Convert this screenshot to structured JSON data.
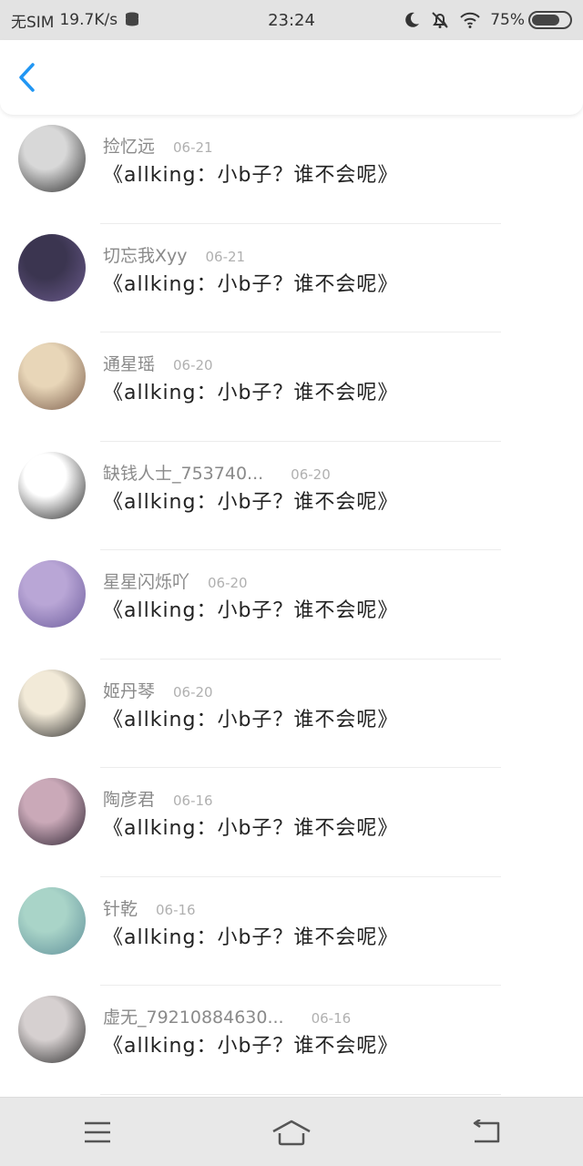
{
  "status_bar": {
    "carrier": "无SIM",
    "speed": "19.7K/s",
    "time": "23:24",
    "battery_text": "75%",
    "battery_level": 0.75,
    "icons": [
      "database-icon",
      "moon-icon",
      "mute-bell-icon",
      "wifi-icon",
      "battery-icon"
    ]
  },
  "header": {
    "back_icon": "chevron-left-icon",
    "accent_color": "#2196f3"
  },
  "comments": [
    {
      "name": "捡忆远",
      "date": "06-21",
      "message": "《allking：小b子？谁不会呢》",
      "avatar_colors": [
        "#d8d8d8",
        "#2a2a2a"
      ]
    },
    {
      "name": "切忘我Xyy",
      "date": "06-21",
      "message": "《allking：小b子？谁不会呢》",
      "avatar_colors": [
        "#3b3550",
        "#6a5a8c"
      ]
    },
    {
      "name": "通星瑶",
      "date": "06-20",
      "message": "《allking：小b子？谁不会呢》",
      "avatar_colors": [
        "#e8d6b8",
        "#7a5c4a"
      ]
    },
    {
      "name": "缺钱人士_753740...",
      "date": "06-20",
      "message": "《allking：小b子？谁不会呢》",
      "avatar_colors": [
        "#ffffff",
        "#222222"
      ]
    },
    {
      "name": "星星闪烁吖",
      "date": "06-20",
      "message": "《allking：小b子？谁不会呢》",
      "avatar_colors": [
        "#b9a6d6",
        "#6c5c9c"
      ]
    },
    {
      "name": "姬丹琴",
      "date": "06-20",
      "message": "《allking：小b子？谁不会呢》",
      "avatar_colors": [
        "#f2ead8",
        "#2c2c2c"
      ]
    },
    {
      "name": "陶彦君",
      "date": "06-16",
      "message": "《allking：小b子？谁不会呢》",
      "avatar_colors": [
        "#caa9b8",
        "#2b2230"
      ]
    },
    {
      "name": "针乾",
      "date": "06-16",
      "message": "《allking：小b子？谁不会呢》",
      "avatar_colors": [
        "#a9d4c8",
        "#5f8f9a"
      ]
    },
    {
      "name": "虚无_79210884630...",
      "date": "06-16",
      "message": "《allking：小b子？谁不会呢》",
      "avatar_colors": [
        "#d6d0d0",
        "#2a2a2a"
      ]
    }
  ],
  "nav_bar": {
    "menu_icon": "menu-icon",
    "home_icon": "home-icon",
    "back_icon": "return-icon"
  }
}
